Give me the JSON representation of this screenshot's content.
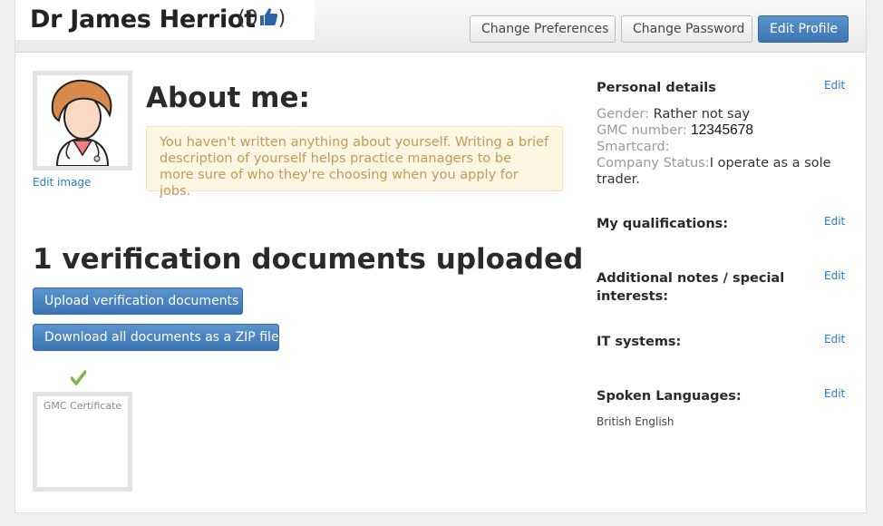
{
  "header": {
    "title": "Dr James Herriot",
    "likes_open": "(0",
    "likes_close": ")",
    "thumb_icon": "thumbs-up-icon",
    "change_preferences": "Change Preferences",
    "change_password": "Change Password",
    "edit_profile": "Edit Profile"
  },
  "profile": {
    "edit_image": "Edit image",
    "about_title": "About me:",
    "about_alert": "You haven't written anything about yourself. Writing a brief description of yourself helps practice managers to be more sure of who they're choosing when you apply for jobs."
  },
  "verification": {
    "title": "1 verification documents uploaded",
    "upload_button": "Upload verification documents",
    "download_button": "Download all documents as a ZIP file",
    "documents": [
      {
        "name": "GMC Certificate",
        "verified": true
      }
    ]
  },
  "sidebar": {
    "edit_label": "Edit",
    "personal_details": {
      "heading": "Personal details",
      "gender_label": "Gender:",
      "gender_value": " Rather not say",
      "gmc_label": "GMC number:",
      "gmc_value": " 12345678",
      "smartcard_label": "Smartcard:",
      "company_label": "Company Status:",
      "company_value": "I operate as a sole trader."
    },
    "qualifications_heading": "My qualifications:",
    "notes_heading": "Additional notes / special interests:",
    "it_systems_heading": "IT systems:",
    "languages_heading": "Spoken Languages:",
    "languages_value": "British English"
  },
  "colors": {
    "primary": "#3b74b2",
    "link": "#2a7bc0",
    "alert_bg": "#fcf6e3",
    "alert_text": "#c19a55",
    "check": "#7ab648"
  }
}
